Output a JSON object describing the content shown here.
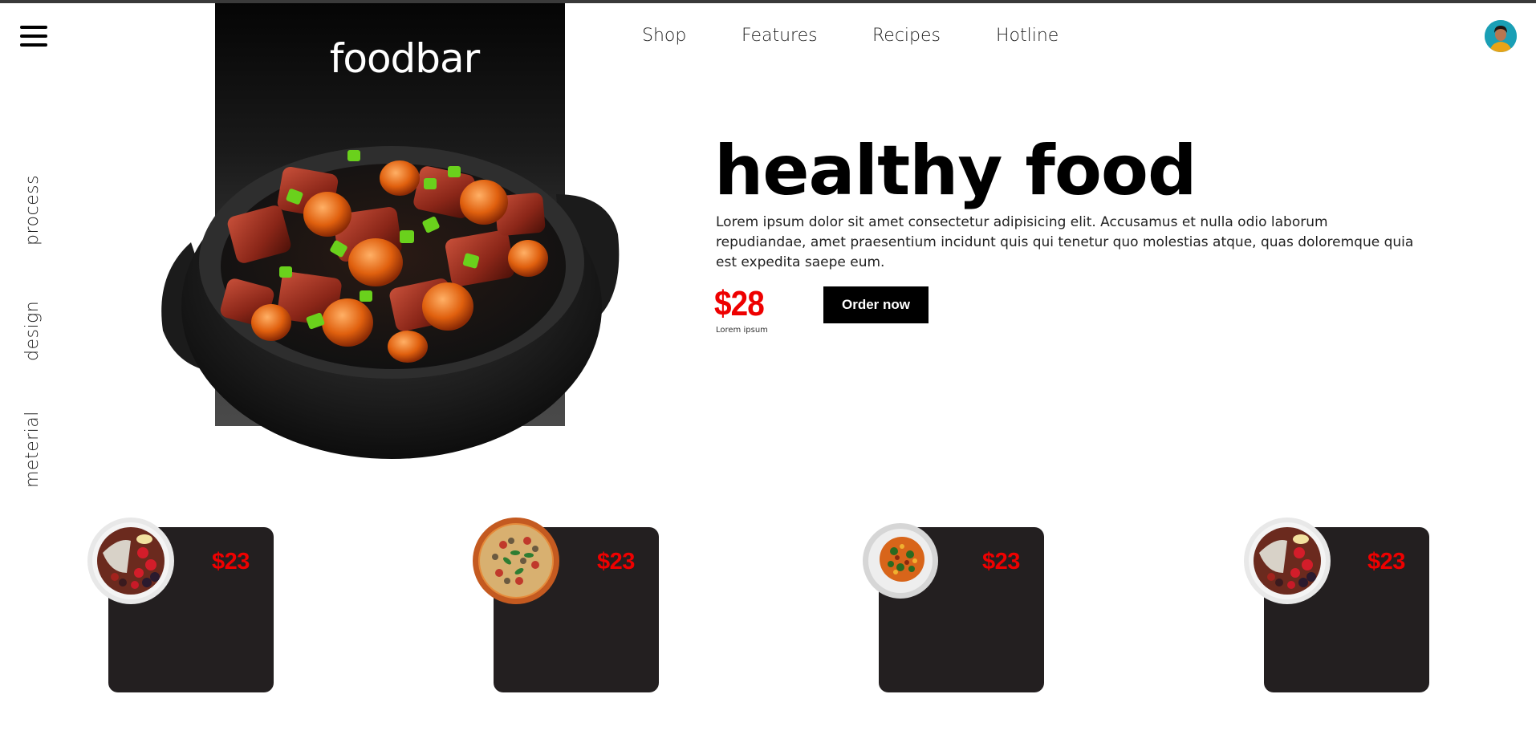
{
  "brand": "foodbar",
  "nav": {
    "items": [
      {
        "label": "Shop"
      },
      {
        "label": "Features"
      },
      {
        "label": "Recipes"
      },
      {
        "label": "Hotline"
      }
    ]
  },
  "sidebar": {
    "items": [
      {
        "label": "process"
      },
      {
        "label": "design"
      },
      {
        "label": "meterial"
      }
    ]
  },
  "hero": {
    "title": "healthy food",
    "description": "Lorem ipsum dolor sit amet consectetur adipisicing elit. Accusamus et nulla odio laborum repudiandae, amet praesentium incidunt quis qui tenetur quo molestias atque, quas doloremque quia est expedita saepe eum.",
    "price": "$28",
    "price_caption": "Lorem ipsum",
    "order_label": "Order now"
  },
  "cards": [
    {
      "price": "$23",
      "image": "fruit-bowl"
    },
    {
      "price": "$23",
      "image": "pizza"
    },
    {
      "price": "$23",
      "image": "pasta-plate"
    },
    {
      "price": "$23",
      "image": "fruit-bowl"
    }
  ],
  "colors": {
    "accent": "#ee0000",
    "card_bg": "#231f20",
    "button_bg": "#000000"
  }
}
